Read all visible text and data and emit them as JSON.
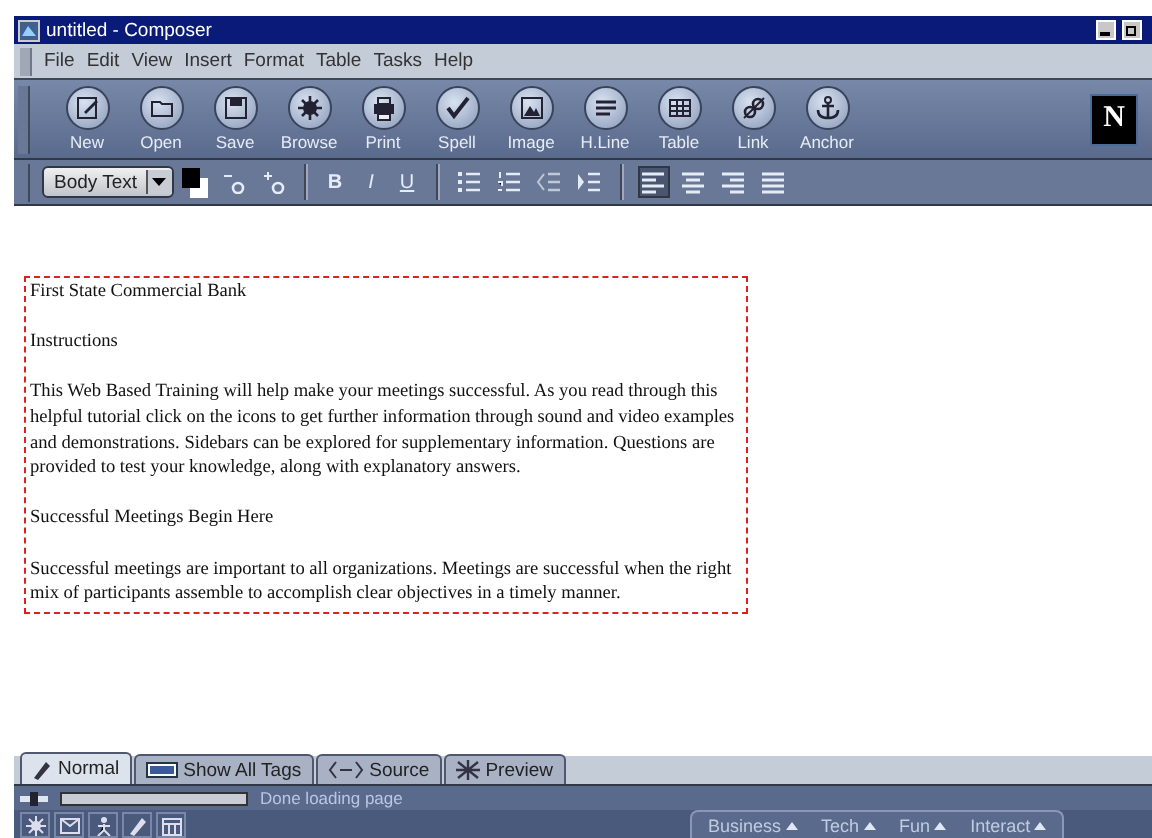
{
  "window": {
    "title": "untitled - Composer"
  },
  "menu": [
    "File",
    "Edit",
    "View",
    "Insert",
    "Format",
    "Table",
    "Tasks",
    "Help"
  ],
  "toolbar": [
    "New",
    "Open",
    "Save",
    "Browse",
    "Print",
    "Spell",
    "Image",
    "H.Line",
    "Table",
    "Link",
    "Anchor"
  ],
  "logo": "N",
  "format_bar": {
    "paragraph_style": "Body Text",
    "text_styles": [
      "B",
      "I",
      "U"
    ],
    "alignments": [
      {
        "selected": true
      },
      {
        "selected": false
      },
      {
        "selected": false
      },
      {
        "selected": false
      }
    ]
  },
  "document": {
    "paragraphs": [
      "First State Commercial Bank",
      "Instructions",
      "This Web Based Training will help make your meetings successful. As you read through this helpful tutorial click on the icons to get further information through sound and video examples and demonstrations. Sidebars can be explored for supplementary information. Questions are provided to test your knowledge, along with explanatory answers.",
      "Successful Meetings Begin Here",
      "Successful meetings are important to all organizations. Meetings are successful when the right mix of participants assemble to accomplish clear objectives in a timely manner."
    ]
  },
  "tabs": [
    {
      "label": "Normal",
      "selected": true
    },
    {
      "label": "Show All Tags",
      "selected": false
    },
    {
      "label": "Source",
      "selected": false
    },
    {
      "label": "Preview",
      "selected": false
    }
  ],
  "status_bar": {
    "message": "Done loading page"
  },
  "quick_links": [
    "Business",
    "Tech",
    "Fun",
    "Interact"
  ]
}
